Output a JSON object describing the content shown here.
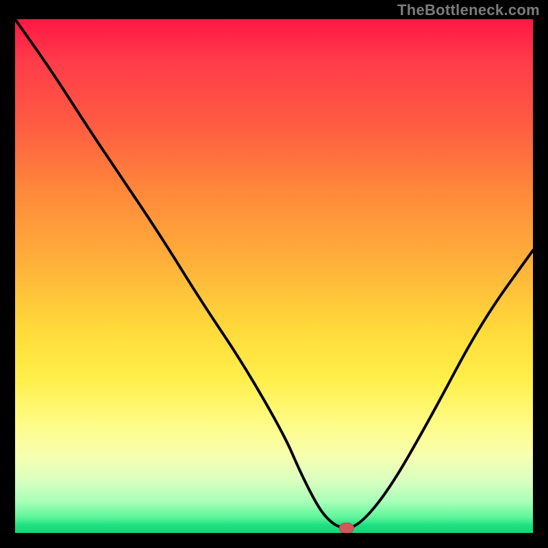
{
  "watermark": "TheBottleneck.com",
  "colors": {
    "background": "#000000",
    "curve": "#000000",
    "marker": "#cf5a5a",
    "gradient_top": "#ff1744",
    "gradient_bottom": "#13d877"
  },
  "chart_data": {
    "type": "line",
    "title": "",
    "xlabel": "",
    "ylabel": "",
    "xlim": [
      0,
      100
    ],
    "ylim": [
      0,
      100
    ],
    "grid": false,
    "legend": false,
    "series": [
      {
        "name": "bottleneck-curve",
        "x": [
          0,
          7,
          14,
          20,
          28,
          36,
          44,
          52,
          55,
          58,
          60,
          62.5,
          66,
          72,
          80,
          90,
          100
        ],
        "values": [
          100,
          90,
          79,
          70,
          58,
          45,
          33,
          19,
          12,
          6,
          3,
          1,
          1,
          8,
          22,
          41,
          55
        ]
      }
    ],
    "markers": [
      {
        "name": "optimal-point",
        "x": 64,
        "y": 1
      }
    ]
  }
}
